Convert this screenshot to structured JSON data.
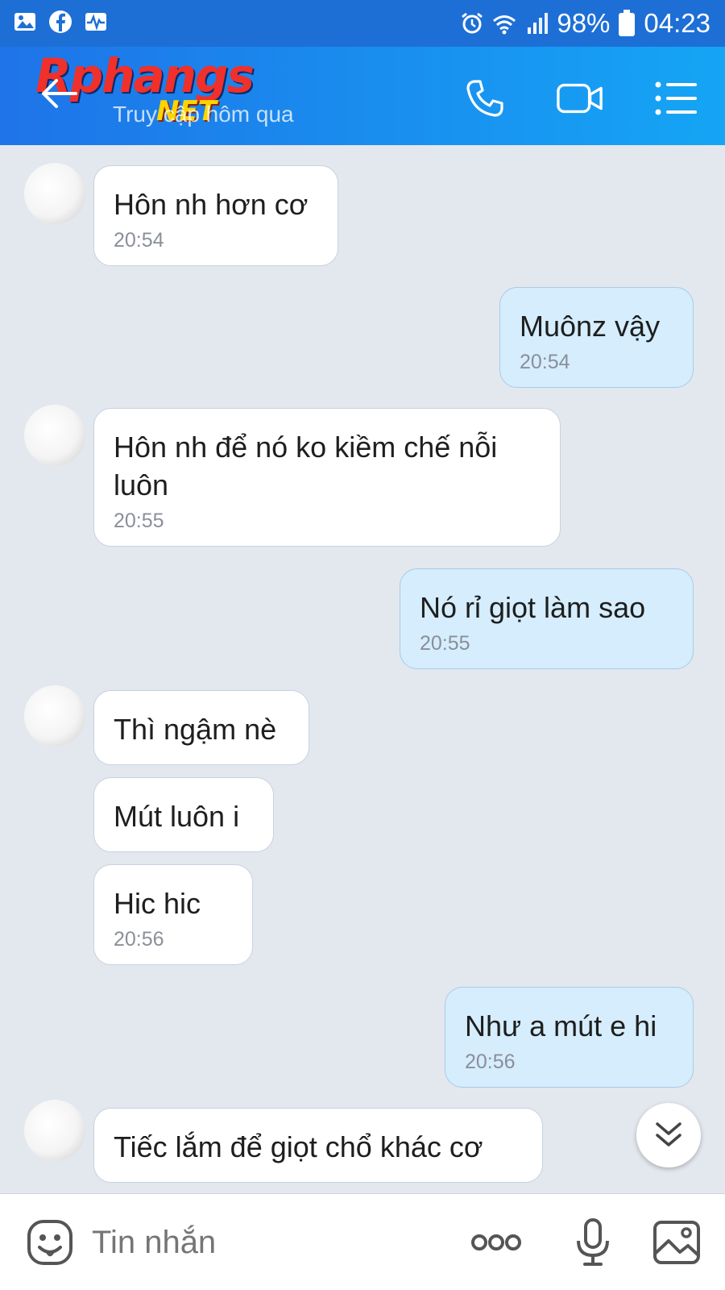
{
  "status_bar": {
    "battery": "98%",
    "time": "04:23"
  },
  "header": {
    "logo_main": "Rphangs",
    "logo_sub": "NET",
    "last_seen": "Truy cập hôm qua"
  },
  "messages": [
    {
      "side": "in",
      "text": "Hôn nh hơn cơ",
      "time": "20:54"
    },
    {
      "side": "out",
      "text": "Muônz vậy",
      "time": "20:54"
    },
    {
      "side": "in",
      "text": "Hôn nh để nó ko kiềm chế nỗi luôn",
      "time": "20:55"
    },
    {
      "side": "out",
      "text": "Nó rỉ giọt làm sao",
      "time": "20:55"
    },
    {
      "side": "in",
      "text": "Thì ngậm nè"
    },
    {
      "side": "in",
      "text": "Mút luôn i"
    },
    {
      "side": "in",
      "text": "Hic hic",
      "time": "20:56"
    },
    {
      "side": "out",
      "text": "Như a mút e hi",
      "time": "20:56"
    },
    {
      "side": "in",
      "text": "Tiếc lắm để giọt chổ khác cơ"
    }
  ],
  "composer": {
    "placeholder": "Tin nhắn"
  },
  "colors": {
    "header_start": "#1e74e8",
    "header_end": "#15a5f5",
    "outgoing_bubble": "#d5edfd",
    "chat_background": "#e3e7ee"
  },
  "icons": [
    "gallery-icon",
    "facebook-icon",
    "activity-icon",
    "alarm-icon",
    "wifi-icon",
    "signal-icon",
    "battery-icon",
    "back-arrow-icon",
    "phone-icon",
    "video-call-icon",
    "menu-icon",
    "chevron-double-down-icon",
    "sticker-icon",
    "more-dots-icon",
    "microphone-icon",
    "image-icon"
  ]
}
